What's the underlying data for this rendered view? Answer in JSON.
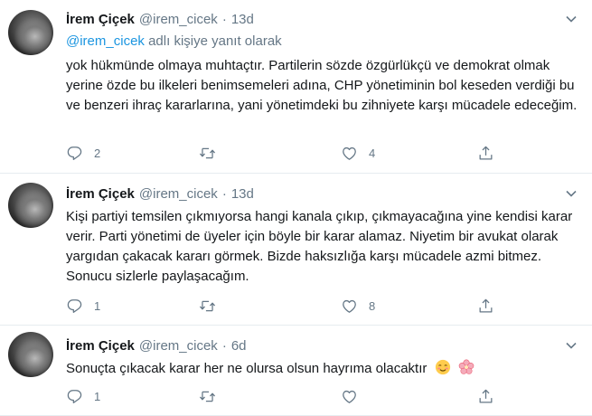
{
  "tweets": [
    {
      "name": "İrem Çiçek",
      "handle": "@irem_cicek",
      "separator": "·",
      "time": "13d",
      "reply_mention": "@irem_cicek",
      "reply_suffix": " adlı kişiye yanıt olarak",
      "text": "yok hükmünde olmaya muhtaçtır. Partilerin sözde özgürlükçü ve demokrat olmak yerine özde bu ilkeleri benimsemeleri adına, CHP yönetiminin bol keseden verdiği bu ve benzeri ihraç kararlarına, yani yönetimdeki bu zihniyete karşı mücadele edeceğim.",
      "reply_count": "2",
      "retweet_count": "",
      "like_count": "4"
    },
    {
      "name": "İrem Çiçek",
      "handle": "@irem_cicek",
      "separator": "·",
      "time": "13d",
      "text": "Kişi partiyi temsilen çıkmıyorsa hangi kanala çıkıp, çıkmayacağına yine kendisi karar verir. Parti yönetimi de üyeler için böyle bir karar alamaz. Niyetim bir avukat olarak yargıdan çakacak kararı görmek. Bizde haksızlığa karşı mücadele azmi bitmez. Sonucu sizlerle paylaşacağım.",
      "reply_count": "1",
      "retweet_count": "",
      "like_count": "8"
    },
    {
      "name": "İrem Çiçek",
      "handle": "@irem_cicek",
      "separator": "·",
      "time": "6d",
      "text": "Sonuçta çıkacak karar her ne olursa olsun hayrıma olacaktır",
      "emojis": [
        "smiling-blush-emoji",
        "cherry-blossom-emoji"
      ],
      "reply_count": "1",
      "retweet_count": "",
      "like_count": ""
    }
  ],
  "icons": {
    "reply": "reply-icon",
    "retweet": "retweet-icon",
    "like": "like-icon",
    "share": "share-icon",
    "more": "chevron-down-icon"
  },
  "colors": {
    "text": "#14171a",
    "secondary": "#657786",
    "link": "#1b95e0",
    "border": "#e6ecf0"
  }
}
